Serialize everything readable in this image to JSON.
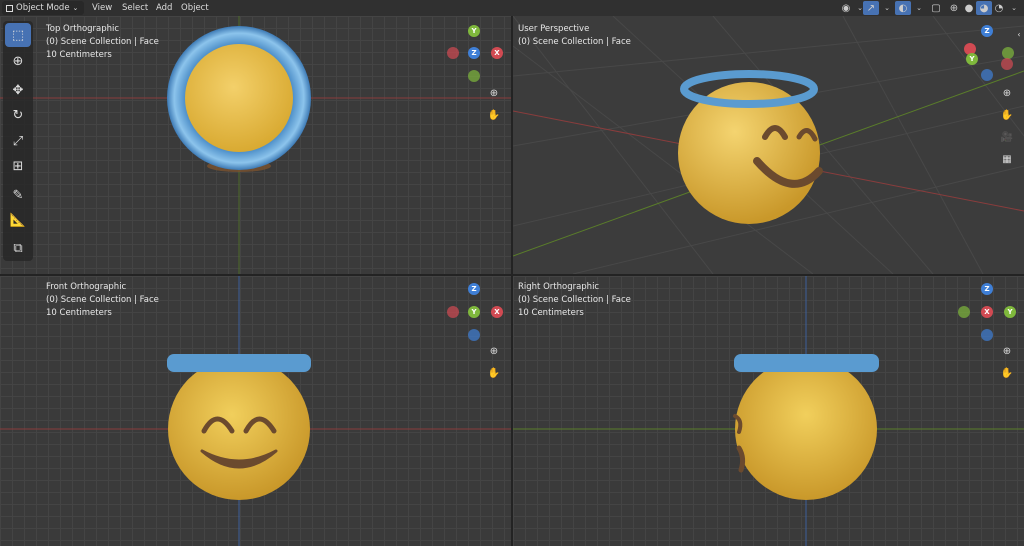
{
  "header": {
    "mode": "Object Mode",
    "menus": [
      "View",
      "Select",
      "Add",
      "Object"
    ]
  },
  "viewports": [
    {
      "title": "Top Orthographic",
      "collection": "(0) Scene Collection | Face",
      "scale": "10 Centimeters"
    },
    {
      "title": "User Perspective",
      "collection": "(0) Scene Collection | Face",
      "scale": ""
    },
    {
      "title": "Front Orthographic",
      "collection": "(0) Scene Collection | Face",
      "scale": "10 Centimeters"
    },
    {
      "title": "Right Orthographic",
      "collection": "(0) Scene Collection | Face",
      "scale": "10 Centimeters"
    }
  ],
  "gizmo_labels": {
    "x": "X",
    "y": "Y",
    "z": "Z"
  },
  "colors": {
    "face": "#f0c040",
    "halo": "#5a9bd0",
    "mouth": "#6b4a2e",
    "x_axis": "#d14a52",
    "y_axis": "#7fb83c",
    "z_axis": "#3f7fd6"
  },
  "toolbar": [
    "select-box-icon",
    "cursor-icon",
    "move-icon",
    "rotate-icon",
    "scale-icon",
    "transform-icon",
    "annotate-icon",
    "measure-icon",
    "add-cube-icon"
  ]
}
